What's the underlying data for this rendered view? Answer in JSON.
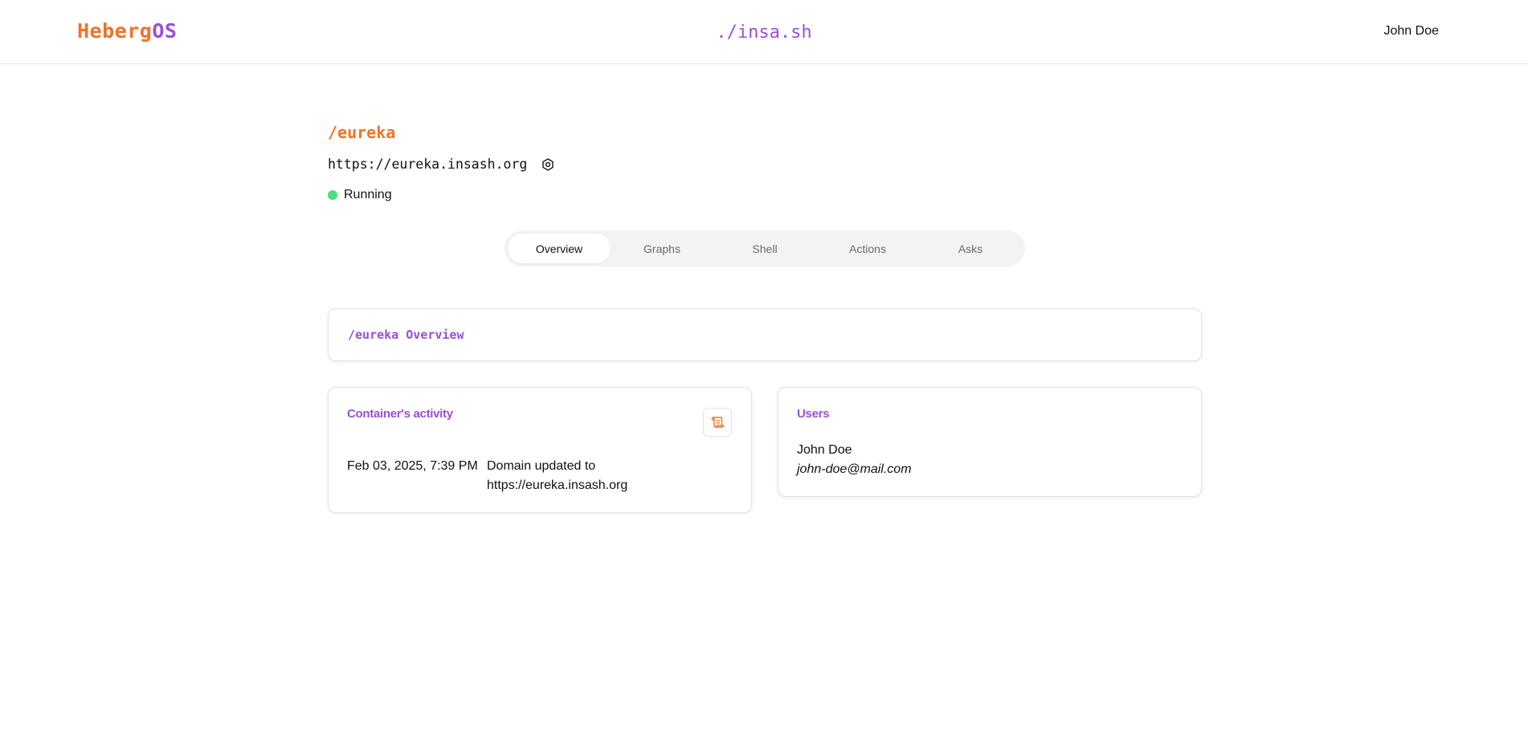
{
  "header": {
    "logo_part1": "Heberg",
    "logo_part2": "OS",
    "center_brand": "./insa.sh",
    "user_name": "John Doe"
  },
  "project": {
    "title": "/eureka",
    "url": "https://eureka.insash.org",
    "settings_icon": "gear-icon",
    "status": "Running",
    "status_color": "#4ade80"
  },
  "tabs": [
    {
      "label": "Overview",
      "active": true
    },
    {
      "label": "Graphs",
      "active": false
    },
    {
      "label": "Shell",
      "active": false
    },
    {
      "label": "Actions",
      "active": false
    },
    {
      "label": "Asks",
      "active": false
    }
  ],
  "overview_card": {
    "title": "/eureka Overview"
  },
  "activity_card": {
    "heading": "Container's activity",
    "log_icon": "scroll-icon",
    "entries": [
      {
        "date": "Feb 03, 2025, 7:39 PM",
        "description": "Domain updated to https://eureka.insash.org"
      }
    ]
  },
  "users_card": {
    "heading": "Users",
    "users": [
      {
        "name": "John Doe",
        "email": "john-doe@mail.com"
      }
    ]
  },
  "colors": {
    "accent_orange": "#f07327",
    "accent_purple": "#9a4fd6"
  }
}
